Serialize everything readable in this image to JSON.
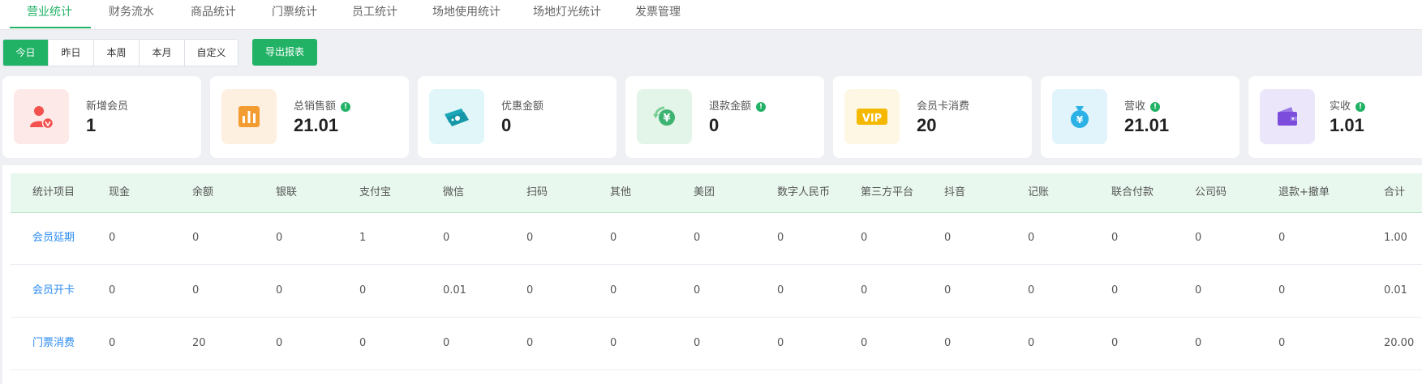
{
  "tabs": [
    {
      "label": "营业统计",
      "active": true
    },
    {
      "label": "财务流水"
    },
    {
      "label": "商品统计"
    },
    {
      "label": "门票统计"
    },
    {
      "label": "员工统计"
    },
    {
      "label": "场地使用统计"
    },
    {
      "label": "场地灯光统计"
    },
    {
      "label": "发票管理"
    }
  ],
  "toolbar": {
    "periods": [
      {
        "label": "今日",
        "active": true
      },
      {
        "label": "昨日"
      },
      {
        "label": "本周"
      },
      {
        "label": "本月"
      },
      {
        "label": "自定义"
      }
    ],
    "export_label": "导出报表"
  },
  "cards": [
    {
      "label": "新增会员",
      "value": "1",
      "icon": "member-add-icon",
      "color": "#f2514d",
      "bg": "#fde9e8",
      "info": false
    },
    {
      "label": "总销售额",
      "value": "21.01",
      "icon": "sales-chart-icon",
      "color": "#f39c31",
      "bg": "#fdf0e0",
      "info": true
    },
    {
      "label": "优惠金额",
      "value": "0",
      "icon": "coupon-icon",
      "color": "#1ba7b8",
      "bg": "#e0f6f9",
      "info": false
    },
    {
      "label": "退款金额",
      "value": "0",
      "icon": "refund-icon",
      "color": "#3cb371",
      "bg": "#e3f5e9",
      "info": true
    },
    {
      "label": "会员卡消费",
      "value": "20",
      "icon": "vip-card-icon",
      "color": "#f5b800",
      "bg": "#fdf7e3",
      "info": false
    },
    {
      "label": "营收",
      "value": "21.01",
      "icon": "money-bag-icon",
      "color": "#2bb1e6",
      "bg": "#e1f3fb",
      "info": true
    },
    {
      "label": "实收",
      "value": "1.01",
      "icon": "wallet-icon",
      "color": "#7c4ddc",
      "bg": "#ece6fb",
      "info": true
    }
  ],
  "table": {
    "headers": [
      "统计项目",
      "现金",
      "余额",
      "银联",
      "支付宝",
      "微信",
      "扫码",
      "其他",
      "美团",
      "数字人民币",
      "第三方平台",
      "抖音",
      "记账",
      "联合付款",
      "公司码",
      "退款+撤单",
      "合计"
    ],
    "rows": [
      [
        "会员延期",
        "0",
        "0",
        "0",
        "1",
        "0",
        "0",
        "0",
        "0",
        "0",
        "0",
        "0",
        "0",
        "0",
        "0",
        "0",
        "1.00"
      ],
      [
        "会员开卡",
        "0",
        "0",
        "0",
        "0",
        "0.01",
        "0",
        "0",
        "0",
        "0",
        "0",
        "0",
        "0",
        "0",
        "0",
        "0",
        "0.01"
      ],
      [
        "门票消费",
        "0",
        "20",
        "0",
        "0",
        "0",
        "0",
        "0",
        "0",
        "0",
        "0",
        "0",
        "0",
        "0",
        "0",
        "0",
        "20.00"
      ]
    ]
  },
  "colors": {
    "accent": "#22b266",
    "link": "#2d8cf0",
    "header_bg": "#e9f8ef"
  }
}
